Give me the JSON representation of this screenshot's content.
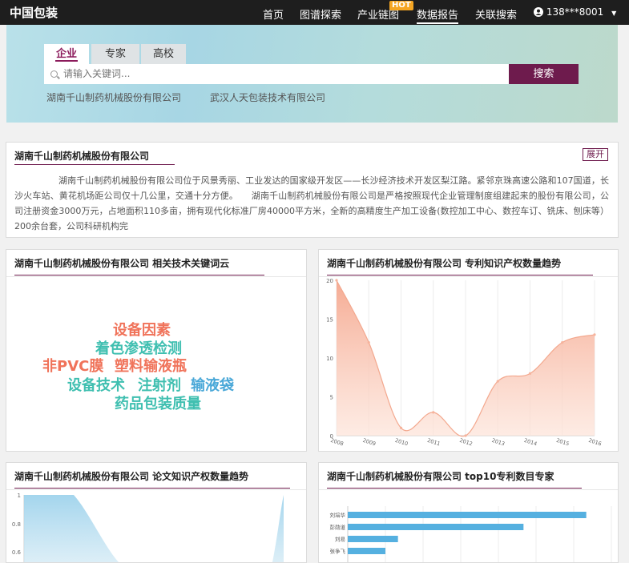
{
  "header": {
    "logo": "中国包装",
    "nav": [
      "首页",
      "图谱探索",
      "产业链图",
      "数据报告",
      "关联搜索"
    ],
    "hot_badge": "HOT",
    "user": "138***8001"
  },
  "search": {
    "tabs": [
      "企业",
      "专家",
      "高校"
    ],
    "active_tab": "企业",
    "placeholder": "请输入关键词...",
    "button": "搜索",
    "hot_links": [
      "湖南千山制药机械股份有限公司",
      "武汉人天包装技术有限公司"
    ]
  },
  "company": {
    "title": "湖南千山制药机械股份有限公司",
    "expand_label": "展开",
    "intro": "湖南千山制药机械股份有限公司位于风景秀丽、工业发达的国家级开发区——长沙经济技术开发区梨江路。紧邻京珠高速公路和107国道，长沙火车站、黄花机场距公司仅十几公里，交通十分方便。　　湖南千山制药机械股份有限公司是严格按照现代企业管理制度组建起来的股份有限公司，公司注册资金3000万元，占地面积110多亩，拥有现代化标准厂房40000平方米，全新的高精度生产加工设备(数控加工中心、数控车订、铣床、刨床等）200余台套，公司科研机构完"
  },
  "wordcloud": {
    "title": "湖南千山制药机械股份有限公司 相关技术关键词云",
    "words": [
      {
        "text": "设备因素",
        "color": "#f0735a"
      },
      {
        "text": "着色渗透检测",
        "color": "#3fbfb0"
      },
      {
        "text": "非PVC膜",
        "color": "#f0735a"
      },
      {
        "text": "塑料输液瓶",
        "color": "#f0735a"
      },
      {
        "text": "设备技术",
        "color": "#3fbfb0"
      },
      {
        "text": "注射剂",
        "color": "#3fbfb0"
      },
      {
        "text": "输液袋",
        "color": "#4aa8d8"
      },
      {
        "text": "药品包装质量",
        "color": "#3fbfb0"
      }
    ]
  },
  "chart_data": [
    {
      "type": "area",
      "title": "湖南千山制药机械股份有限公司 专利知识产权数量趋势",
      "x": [
        "2008",
        "2009",
        "2010",
        "2011",
        "2012",
        "2013",
        "2014",
        "2015",
        "2016"
      ],
      "y": [
        20,
        12,
        1,
        3,
        0,
        7,
        8,
        12,
        13
      ],
      "ylim": [
        0,
        20
      ],
      "yticks": [
        "0",
        "5",
        "10",
        "15",
        "20"
      ],
      "color": "#f5a78e"
    },
    {
      "type": "area",
      "title": "湖南千山制药机械股份有限公司 论文知识产权数量趋势",
      "yticks": [
        "1",
        "0.8",
        "0.6"
      ],
      "color": "#9fd3ec"
    },
    {
      "type": "bar",
      "title": "湖南千山制药机械股份有限公司 top10专利数目专家",
      "categories": [
        "刘培华",
        "彭勋道",
        "刘易",
        "张争飞"
      ],
      "values": [
        19,
        14,
        4,
        3
      ],
      "xmax": 21,
      "color": "#55b0e0"
    }
  ]
}
